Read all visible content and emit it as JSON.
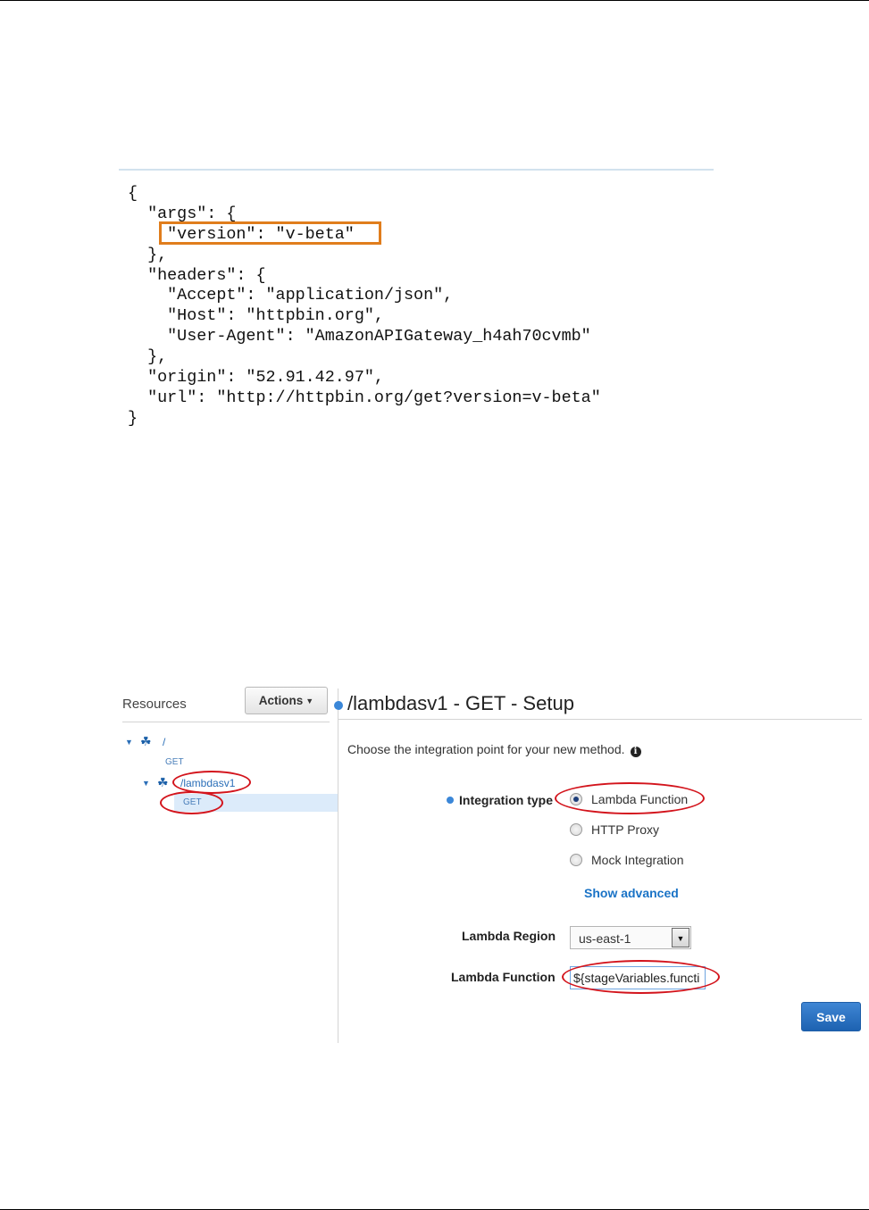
{
  "json_response": {
    "lines": [
      "{",
      "  \"args\": {",
      "    \"version\": \"v-beta\"",
      "  },",
      "  \"headers\": {",
      "    \"Accept\": \"application/json\",",
      "    \"Host\": \"httpbin.org\",",
      "    \"User-Agent\": \"AmazonAPIGateway_h4ah70cvmb\"",
      "  },",
      "  \"origin\": \"52.91.42.97\",",
      "  \"url\": \"http://httpbin.org/get?version=v-beta\"",
      "}"
    ]
  },
  "console": {
    "resources_title": "Resources",
    "actions_label": "Actions",
    "tree": {
      "root_path": "/",
      "root_method": "GET",
      "child_path": "/lambdasv1",
      "child_method": "GET"
    },
    "page_title": "/lambdasv1 - GET - Setup",
    "intro": "Choose the integration point for your new method.",
    "integration_type_label": "Integration type",
    "radio_options": [
      "Lambda Function",
      "HTTP Proxy",
      "Mock Integration"
    ],
    "selected_option": "Lambda Function",
    "show_advanced": "Show advanced",
    "lambda_region_label": "Lambda Region",
    "lambda_region_value": "us-east-1",
    "lambda_function_label": "Lambda Function",
    "lambda_function_value": "${stageVariables.functi",
    "save_label": "Save"
  },
  "colors": {
    "highlight_box": "#e07d1c",
    "annotation_ellipse": "#d3141c",
    "accent": "#1a73c6",
    "save_button": "#2a6fbf"
  },
  "icons": [
    "resource-icon",
    "info-icon",
    "caret-down-icon",
    "dropdown-arrow-icon",
    "tree-expand-icon"
  ]
}
